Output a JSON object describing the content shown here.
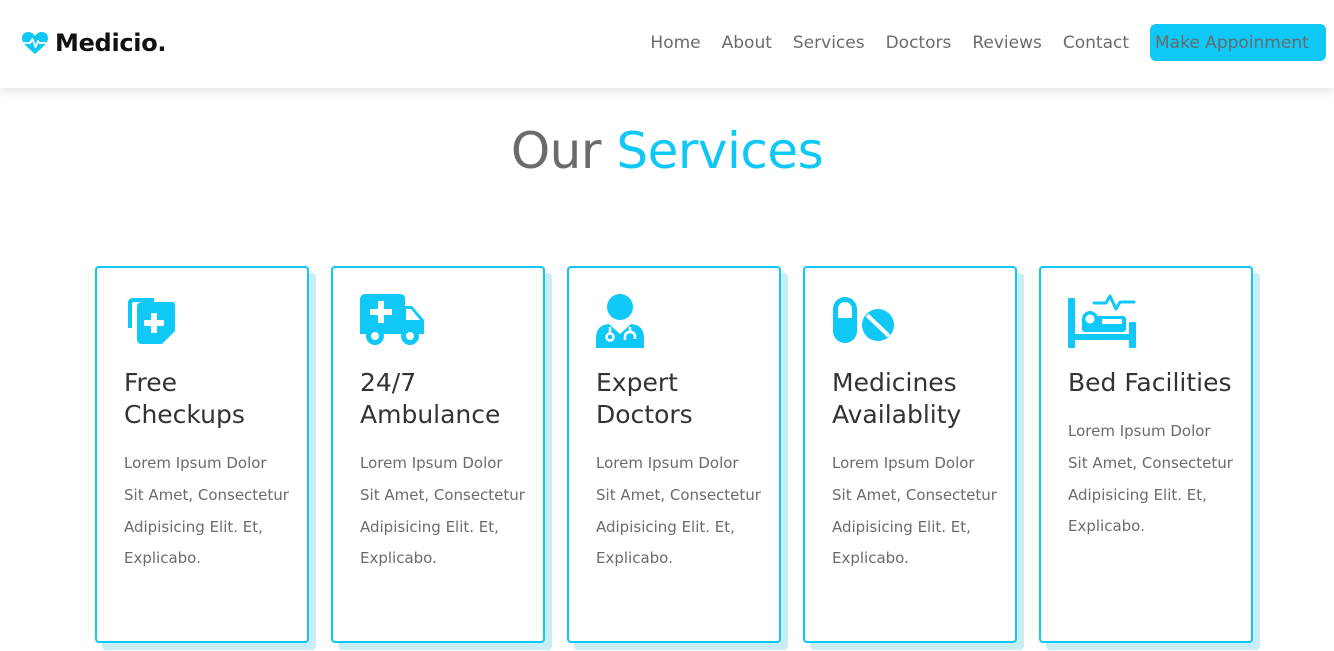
{
  "brand": {
    "name": "Medicio.",
    "icon": "heart-pulse-icon",
    "accent_color": "#0fc8f5"
  },
  "nav": {
    "items": [
      "Home",
      "About",
      "Services",
      "Doctors",
      "Reviews",
      "Contact"
    ],
    "cta_label": "Make Appoinment"
  },
  "section": {
    "title_plain": "Our",
    "title_accent": "Services"
  },
  "services": [
    {
      "icon": "notes-medical-icon",
      "title": "Free Checkups",
      "text": "Lorem Ipsum Dolor Sit Amet, Consectetur Adipisicing Elit. Et, Explicabo."
    },
    {
      "icon": "ambulance-icon",
      "title": "24/7 Ambulance",
      "text": "Lorem Ipsum Dolor Sit Amet, Consectetur Adipisicing Elit. Et, Explicabo."
    },
    {
      "icon": "user-doctor-icon",
      "title": "Expert Doctors",
      "text": "Lorem Ipsum Dolor Sit Amet, Consectetur Adipisicing Elit. Et, Explicabo."
    },
    {
      "icon": "pills-icon",
      "title": "Medicines Availablity",
      "text": "Lorem Ipsum Dolor Sit Amet, Consectetur Adipisicing Elit. Et, Explicabo."
    },
    {
      "icon": "procedures-bed-icon",
      "title": "Bed Facilities",
      "text": "Lorem Ipsum Dolor Sit Amet, Consectetur Adipisicing Elit. Et, Explicabo."
    }
  ]
}
